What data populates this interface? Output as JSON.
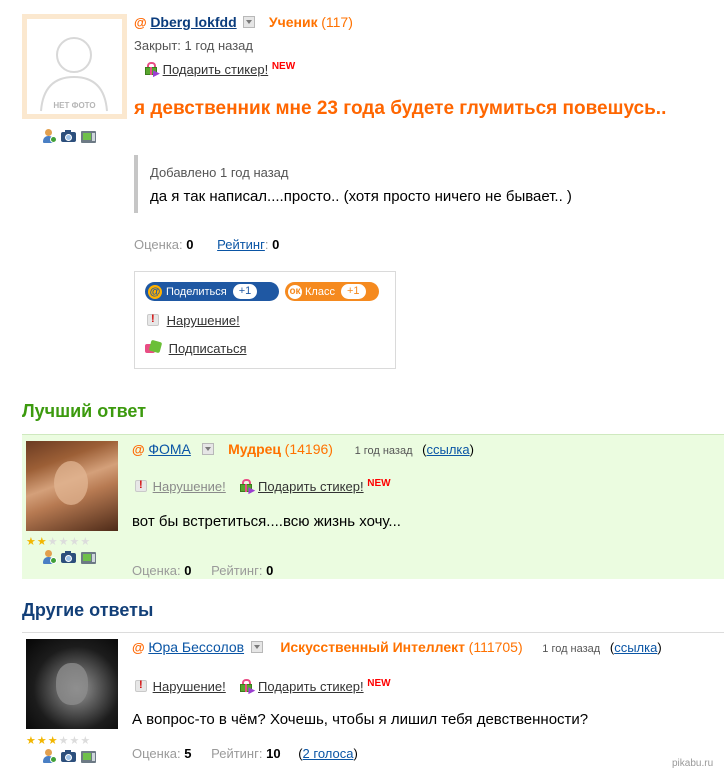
{
  "question": {
    "avatar_label": "НЕТ ФОТО",
    "author": "Dberg lokfdd",
    "rank": "Ученик",
    "points": "(117)",
    "status": "Закрыт: 1 год назад",
    "gift_label": "Подарить стикер!",
    "new_badge": "NEW",
    "title": "я девственник мне 23 года будете глумиться повешусь..",
    "added_label": "Добавлено 1 год назад",
    "added_text": "да я так написал....просто.. (хотя просто ничего не бывает.. )",
    "score_label": "Оценка:",
    "score": "0",
    "rating_label": "Рейтинг",
    "rating_colon": ":",
    "rating": "0",
    "share_label": "Поделиться",
    "share_count": "+1",
    "class_label": "Класс",
    "class_count": "+1",
    "violation_label": "Нарушение!",
    "subscribe_label": "Подписаться"
  },
  "best_answer": {
    "heading": "Лучший ответ",
    "author": "ФОМА",
    "rank": "Мудрец",
    "points": "(14196)",
    "time": "1 год назад",
    "link_open": "(",
    "link_label": "ссылка",
    "link_close": ")",
    "violation_label": "Нарушение!",
    "gift_label": "Подарить стикер!",
    "new_badge": "NEW",
    "text": "вот бы встретиться....всю жизнь хочу...",
    "score_label": "Оценка:",
    "score": "0",
    "rating_label": "Рейтинг:",
    "rating": "0",
    "stars_on": 2,
    "stars_total": 6
  },
  "other_answers": {
    "heading": "Другие ответы",
    "items": [
      {
        "author": "Юра Бессолов",
        "rank": "Искусственный Интеллект",
        "points": "(111705)",
        "time": "1 год назад",
        "link_open": "(",
        "link_label": "ссылка",
        "link_close": ")",
        "violation_label": "Нарушение!",
        "gift_label": "Подарить стикер!",
        "new_badge": "NEW",
        "text": "А вопрос-то в чём? Хочешь, чтобы я лишил тебя девственности?",
        "score_label": "Оценка:",
        "score": "5",
        "rating_label": "Рейтинг:",
        "rating": "10",
        "votes_label": "2 голоса",
        "stars_on": 3,
        "stars_total": 6
      }
    ]
  },
  "watermark": "pikabu.ru",
  "colors": {
    "accent_orange": "#ff6600",
    "link_blue": "#0a55a5",
    "best_green": "#3c9a0e",
    "best_bg": "#ebfce0",
    "other_blue": "#123f78"
  }
}
